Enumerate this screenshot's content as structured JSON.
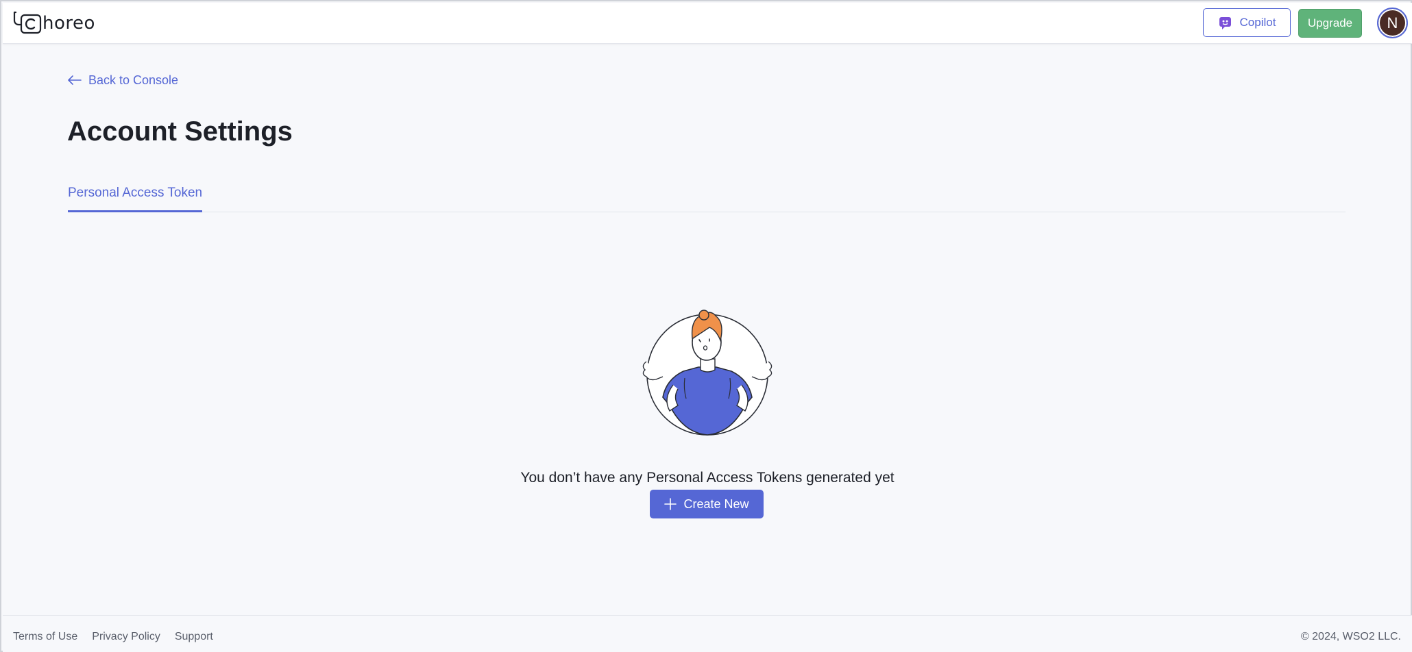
{
  "header": {
    "logo_text": "horeo",
    "copilot_label": "Copilot",
    "upgrade_label": "Upgrade",
    "avatar_initial": "N"
  },
  "main": {
    "back_link": "Back to Console",
    "page_title": "Account Settings",
    "tabs": [
      {
        "label": "Personal Access Token",
        "active": true
      }
    ],
    "empty_state": {
      "message": "You don’t have any Personal Access Tokens generated yet",
      "create_label": "Create New"
    }
  },
  "footer": {
    "links": [
      "Terms of Use",
      "Privacy Policy",
      "Support"
    ],
    "copyright": "© 2024, WSO2 LLC."
  },
  "colors": {
    "accent": "#5567d5",
    "upgrade": "#5fb37a",
    "avatar_bg": "#4a2b24",
    "illustration_shirt": "#5567d5",
    "illustration_hair": "#f0914a"
  }
}
